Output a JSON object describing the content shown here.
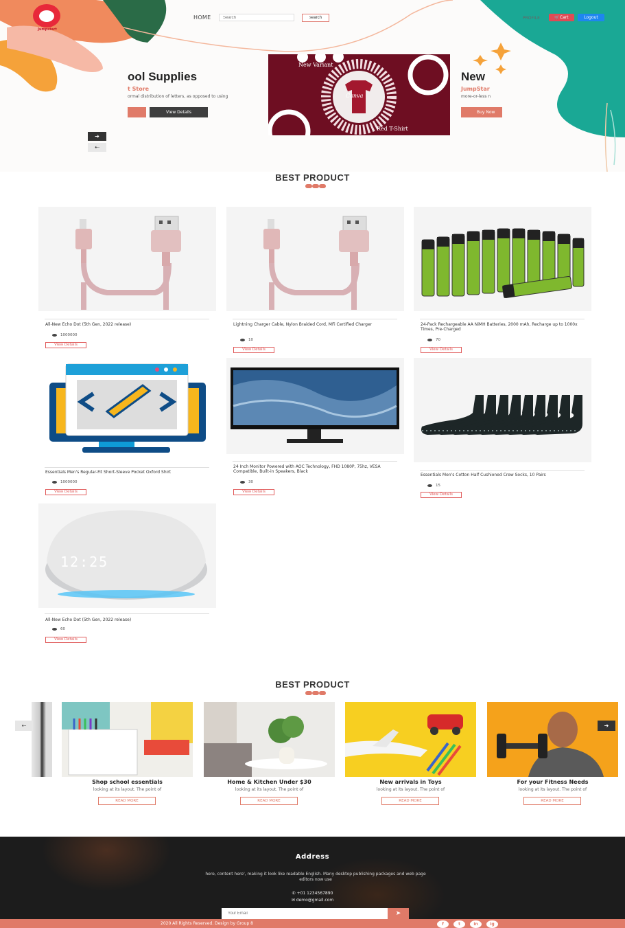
{
  "header": {
    "brand": "Jumpstart",
    "nav_home": "HOME",
    "search_placeholder": "Search",
    "search_button": "search",
    "profile": "PROFILE",
    "cart": "🛒Cart",
    "logout": "Logout"
  },
  "hero": {
    "left_slide": {
      "title": "ool Supplies",
      "subtitle": "t Store",
      "desc": "ormal distribution of letters, as opposed to using",
      "button": "View Details"
    },
    "banner": {
      "top_text": "New Variant",
      "center_text": "Canva",
      "bottom_text": "Red T-Shirt"
    },
    "right_slide": {
      "title": "New",
      "subtitle": "JumpStar",
      "desc": "more-or-less n",
      "button": "Buy Now"
    },
    "next_arrow": "➔",
    "prev_arrow": "⇠"
  },
  "best_product_1": {
    "title": "BEST PRODUCT"
  },
  "products": [
    {
      "name": "All-New Echo Dot (5th Gen, 2022 release)",
      "rating": "1000000",
      "button": "View Details",
      "image_icon": "usb-cable"
    },
    {
      "name": "Lightning Charger Cable, Nylon Braided Cord, MFi Certified Charger",
      "rating": "10",
      "button": "View Details",
      "image_icon": "usb-cable"
    },
    {
      "name": "24-Pack Rechargeable AA NiMH Batteries, 2000 mAh, Recharge up to 1000x Times, Pre-Charged",
      "rating": "70",
      "button": "View Details",
      "image_icon": "batteries"
    },
    {
      "name": "Essentials Men's Regular-Fit Short-Sleeve Pocket Oxford Shirt",
      "rating": "1000000",
      "button": "View Details",
      "image_icon": "code-monitor"
    },
    {
      "name": "24 Inch Monitor Powered with AOC Technology, FHD 1080P, 75hz, VESA Compatible, Built-in Speakers, Black",
      "rating": "30",
      "button": "View Details",
      "image_icon": "monitor"
    },
    {
      "name": "Essentials Men's Cotton Half Cushioned Crew Socks, 10 Pairs",
      "rating": "15",
      "button": "View Details",
      "image_icon": "socks"
    },
    {
      "name": "All-New Echo Dot (5th Gen, 2022 release)",
      "rating": "60",
      "button": "View Details",
      "image_icon": "echo-dot"
    }
  ],
  "best_product_2": {
    "title": "BEST PRODUCT"
  },
  "categories": [
    {
      "title": "Shop school essentials",
      "desc": "looking at its layout. The point of",
      "button": "READ MORE"
    },
    {
      "title": "Home & Kitchen Under $30",
      "desc": "looking at its layout. The point of",
      "button": "READ MORE"
    },
    {
      "title": "New arrivals in Toys",
      "desc": "looking at its layout. The point of",
      "button": "READ MORE"
    },
    {
      "title": "For your Fitness Needs",
      "desc": "looking at its layout. The point of",
      "button": "READ MORE"
    }
  ],
  "carousel": {
    "prev": "⇠",
    "next": "➔"
  },
  "footer": {
    "title": "Address",
    "desc": "here, content here', making it look like readable English. Many desktop publishing packages and web page editors now use",
    "phone": "+01 1234567890",
    "email": "demo@gmail.com",
    "email_placeholder": "Your Email",
    "copyright": "2020 All Rights Reserved. Design by Group 8",
    "social": [
      "f",
      "t",
      "in",
      "ig"
    ]
  },
  "colors": {
    "accent": "#e07a68",
    "banner": "#6e0e22",
    "teal": "#1aa895",
    "cart": "#e04a55",
    "logout": "#1e86f0",
    "footer": "#1c1c1c"
  }
}
